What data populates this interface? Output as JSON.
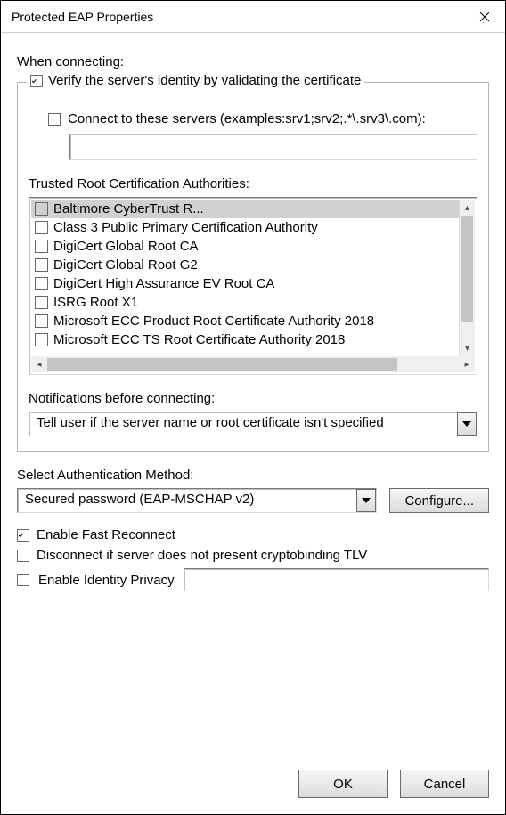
{
  "window": {
    "title": "Protected EAP Properties"
  },
  "when_connecting_label": "When connecting:",
  "verify": {
    "label": "Verify the server's identity by validating the certificate",
    "checked": true
  },
  "connect_servers": {
    "label": "Connect to these servers (examples:srv1;srv2;.*\\.srv3\\.com):",
    "checked": false,
    "value": ""
  },
  "trusted_ca": {
    "label": "Trusted Root Certification Authorities:",
    "items": [
      {
        "label": "Baltimore CyberTrust R...",
        "checked": false,
        "highlighted": true
      },
      {
        "label": "Class 3 Public Primary Certification Authority",
        "checked": false
      },
      {
        "label": "DigiCert Global Root CA",
        "checked": false
      },
      {
        "label": "DigiCert Global Root G2",
        "checked": false
      },
      {
        "label": "DigiCert High Assurance EV Root CA",
        "checked": false
      },
      {
        "label": "ISRG Root X1",
        "checked": false
      },
      {
        "label": "Microsoft ECC Product Root Certificate Authority 2018",
        "checked": false
      },
      {
        "label": "Microsoft ECC TS Root Certificate Authority 2018",
        "checked": false
      }
    ]
  },
  "notifications": {
    "label": "Notifications before connecting:",
    "selected": "Tell user if the server name or root certificate isn't specified"
  },
  "auth_method": {
    "label": "Select Authentication Method:",
    "selected": "Secured password (EAP-MSCHAP v2)",
    "configure_label": "Configure..."
  },
  "options": {
    "fast_reconnect": {
      "label": "Enable Fast Reconnect",
      "checked": true
    },
    "cryptobinding": {
      "label": "Disconnect if server does not present cryptobinding TLV",
      "checked": false
    },
    "identity_privacy": {
      "label": "Enable Identity Privacy",
      "checked": false,
      "value": ""
    }
  },
  "buttons": {
    "ok": "OK",
    "cancel": "Cancel"
  }
}
